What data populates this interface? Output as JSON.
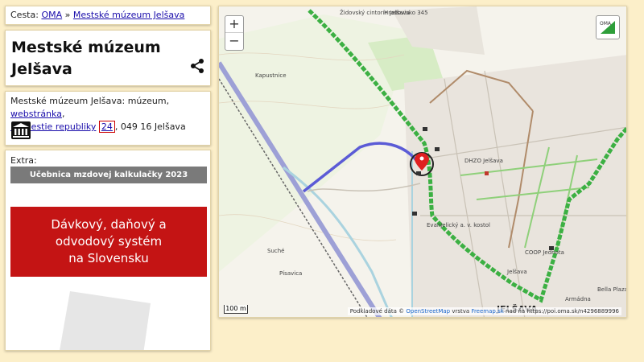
{
  "breadcrumb": {
    "prefix": "Cesta:",
    "root": "OMA",
    "separator": "»",
    "current": "Mestské múzeum Jelšava"
  },
  "title": "Mestské múzeum Jelšava",
  "info": {
    "name": "Mestské múzeum Jelšava",
    "type": "múzeum",
    "website": "webstránka",
    "street": "Námestie republiky",
    "number": "24",
    "postcode_city": "049 16 Jelšava"
  },
  "extra": {
    "label": "Extra:",
    "banner_gray": "Učebnica mzdovej kalkulačky 2023",
    "banner_red": "Dávkový, daňový a odvodový systém na Slovensku"
  },
  "map": {
    "zoom_in": "+",
    "zoom_out": "−",
    "layer_badge": "OMA",
    "scale": "100 m",
    "attribution_prefix": "Podkladové dáta ©",
    "attribution_osm": "OpenStreetMap",
    "attribution_mid": "vrstva",
    "attribution_freemap": "Freemap.sk",
    "attribution_suffix": "nad ňa https://poi.oma.sk/n4296889996",
    "labels": {
      "cemetery": "Židovský cintorín Jelšava",
      "hradovisko": "Hradovisko 345",
      "kapustnice": "Kapustnice",
      "dhzo": "DHZO Jelšava",
      "evanjelicky": "Evanjelický a. v. kostol",
      "coop": "COOP Jednota",
      "jelsava_small": "Jelšava",
      "jelsava_big": "JELŠAVA",
      "bella": "Bella Plaza",
      "armadna": "Armádna",
      "suche": "Suché",
      "pisavica": "Písavica"
    },
    "colors": {
      "route_green": "#3cb043",
      "route_blue": "#5b5bd6",
      "marker_red": "#e02020",
      "water": "#aad3df"
    }
  }
}
